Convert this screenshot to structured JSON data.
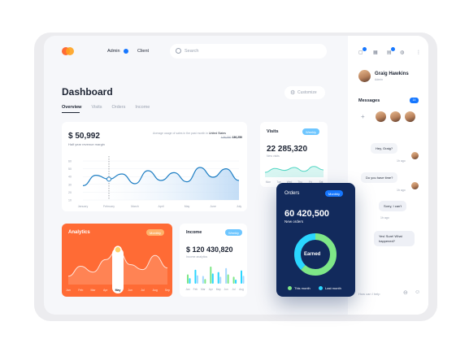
{
  "header": {
    "role_admin": "Admin",
    "role_client": "Client",
    "search_placeholder": "Search"
  },
  "page": {
    "title": "Dashboard",
    "tabs": [
      "Overview",
      "Visits",
      "Orders",
      "Income"
    ],
    "customize_label": "Customize"
  },
  "revenue": {
    "value": "$ 50,992",
    "caption": "Half year revenue margin",
    "avg_text": "Average usage of sales in the past month in",
    "country": "United States",
    "prev_value": "128,250",
    "new_value": "136,250",
    "y_ticks": [
      "60",
      "50",
      "40",
      "30",
      "20",
      "10"
    ],
    "months": [
      "January",
      "February",
      "March",
      "April",
      "May",
      "June",
      "July"
    ],
    "chart_data": {
      "type": "area",
      "categories": [
        "January",
        "February",
        "March",
        "April",
        "May",
        "June",
        "July"
      ],
      "y": [
        22,
        38,
        32,
        40,
        25,
        45,
        30,
        42,
        28,
        50,
        35,
        48,
        30
      ],
      "ylim": [
        0,
        60
      ],
      "highlight_index": 1
    }
  },
  "visits": {
    "title": "Visits",
    "period": "Weekly",
    "value": "22 285,320",
    "caption": "New visits",
    "days": [
      "Mon",
      "Tue",
      "Wed",
      "Thu",
      "Fri",
      "Sat"
    ],
    "chart_data": {
      "type": "line",
      "categories": [
        "Mon",
        "Tue",
        "Wed",
        "Thu",
        "Fri",
        "Sat"
      ],
      "y": [
        10,
        18,
        14,
        20,
        12,
        22,
        15
      ],
      "ylim": [
        0,
        30
      ]
    }
  },
  "analytics": {
    "title": "Analytics",
    "period": "Monthly",
    "months": [
      "Jan",
      "Feb",
      "Mar",
      "Apr",
      "May",
      "Jun",
      "Jul",
      "Aug",
      "Sep"
    ],
    "highlight": "May",
    "chart_data": {
      "type": "area",
      "categories": [
        "Jan",
        "Feb",
        "Mar",
        "Apr",
        "May",
        "Jun",
        "Jul",
        "Aug",
        "Sep"
      ],
      "y": [
        10,
        22,
        15,
        30,
        42,
        24,
        18,
        35,
        20
      ],
      "ylim": [
        0,
        50
      ]
    }
  },
  "income": {
    "title": "Income",
    "period": "Weekly",
    "value": "$ 120 430,820",
    "caption": "Income analytics",
    "months": [
      "Jan",
      "Feb",
      "Mar",
      "Apr",
      "May",
      "Jun",
      "Jul",
      "Aug"
    ],
    "chart_data": {
      "type": "bar",
      "categories": [
        "Jan",
        "Feb",
        "Mar",
        "Apr",
        "May",
        "Jun",
        "Jul",
        "Aug"
      ],
      "values": [
        12,
        18,
        10,
        22,
        15,
        20,
        9,
        17
      ],
      "ylim": [
        0,
        25
      ]
    }
  },
  "orders": {
    "title": "Orders",
    "period": "Monthly",
    "value": "60 420,500",
    "caption": "New orders",
    "center_label": "Earned",
    "legend": [
      "This month",
      "Last month"
    ],
    "chart_data": {
      "type": "pie",
      "categories": [
        "This month",
        "Last month"
      ],
      "values": [
        62,
        38
      ],
      "colors": [
        "#7ee787",
        "#2ad6ff"
      ]
    }
  },
  "sidebar": {
    "user_name": "Graig Hawkins",
    "user_role": "Admin",
    "messages_title": "Messages",
    "messages_count": "14",
    "chat": [
      {
        "text": "Hey, Graig?",
        "time": "1h ago",
        "side": "in"
      },
      {
        "text": "Do you have time?",
        "time": "1h ago",
        "side": "in"
      },
      {
        "text": "Sorry, I can't",
        "time": "1h ago",
        "side": "out"
      },
      {
        "text": "Yes! Sure! What happened?",
        "time": "",
        "side": "out"
      }
    ],
    "input_placeholder": "How can I help"
  },
  "colors": {
    "accent": "#1677ff",
    "analytics_bg": "#ff6b35",
    "orders_bg": "#122a5c",
    "chart_line": "#1f7fc4"
  }
}
